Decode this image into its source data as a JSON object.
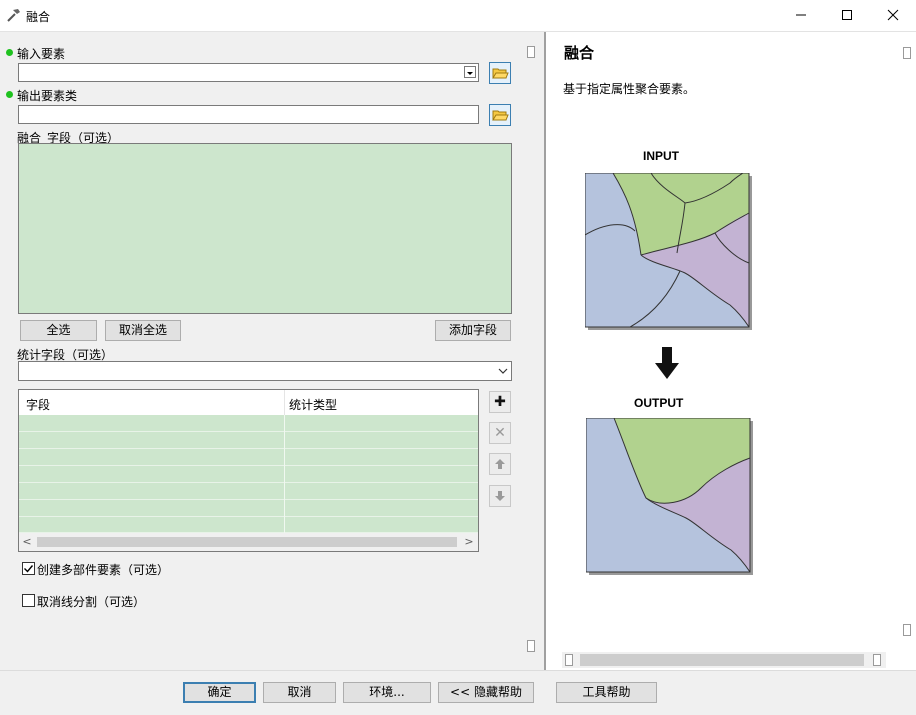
{
  "window": {
    "title": "融合",
    "minimize": "—",
    "maximize": "☐",
    "close": "✕"
  },
  "form": {
    "input_features_label": "输入要素",
    "input_features_value": "",
    "output_class_label": "输出要素类",
    "output_class_value": "",
    "dissolve_fields_label": "融合_字段（可选）",
    "select_all": "全选",
    "unselect_all": "取消全选",
    "add_field": "添加字段",
    "stats_fields_label": "统计字段（可选）",
    "stats_fields_value": "",
    "table": {
      "columns": [
        "字段",
        "统计类型"
      ],
      "rows": [
        [
          "",
          ""
        ],
        [
          "",
          ""
        ],
        [
          "",
          ""
        ],
        [
          "",
          ""
        ],
        [
          "",
          ""
        ],
        [
          "",
          ""
        ],
        [
          "",
          ""
        ]
      ]
    },
    "table_buttons": {
      "add": "✚",
      "remove": "✕",
      "up": "🡅",
      "down": "🡇"
    },
    "multipart_label": "创建多部件要素（可选）",
    "multipart_checked": true,
    "unsplit_label": "取消线分割（可选）",
    "unsplit_checked": false
  },
  "help": {
    "title": "融合",
    "description": "基于指定属性聚合要素。",
    "input_label": "INPUT",
    "output_label": "OUTPUT"
  },
  "buttons": {
    "ok": "确定",
    "cancel": "取消",
    "environments": "环境...",
    "hide_help": "<< 隐藏帮助",
    "tool_help": "工具帮助"
  },
  "colors": {
    "blue_region": "#b5c3dd",
    "green_region": "#b1d28e",
    "purple_region": "#c3b3d3",
    "list_green": "#cde6cd",
    "required_dot": "#1fc21f"
  }
}
